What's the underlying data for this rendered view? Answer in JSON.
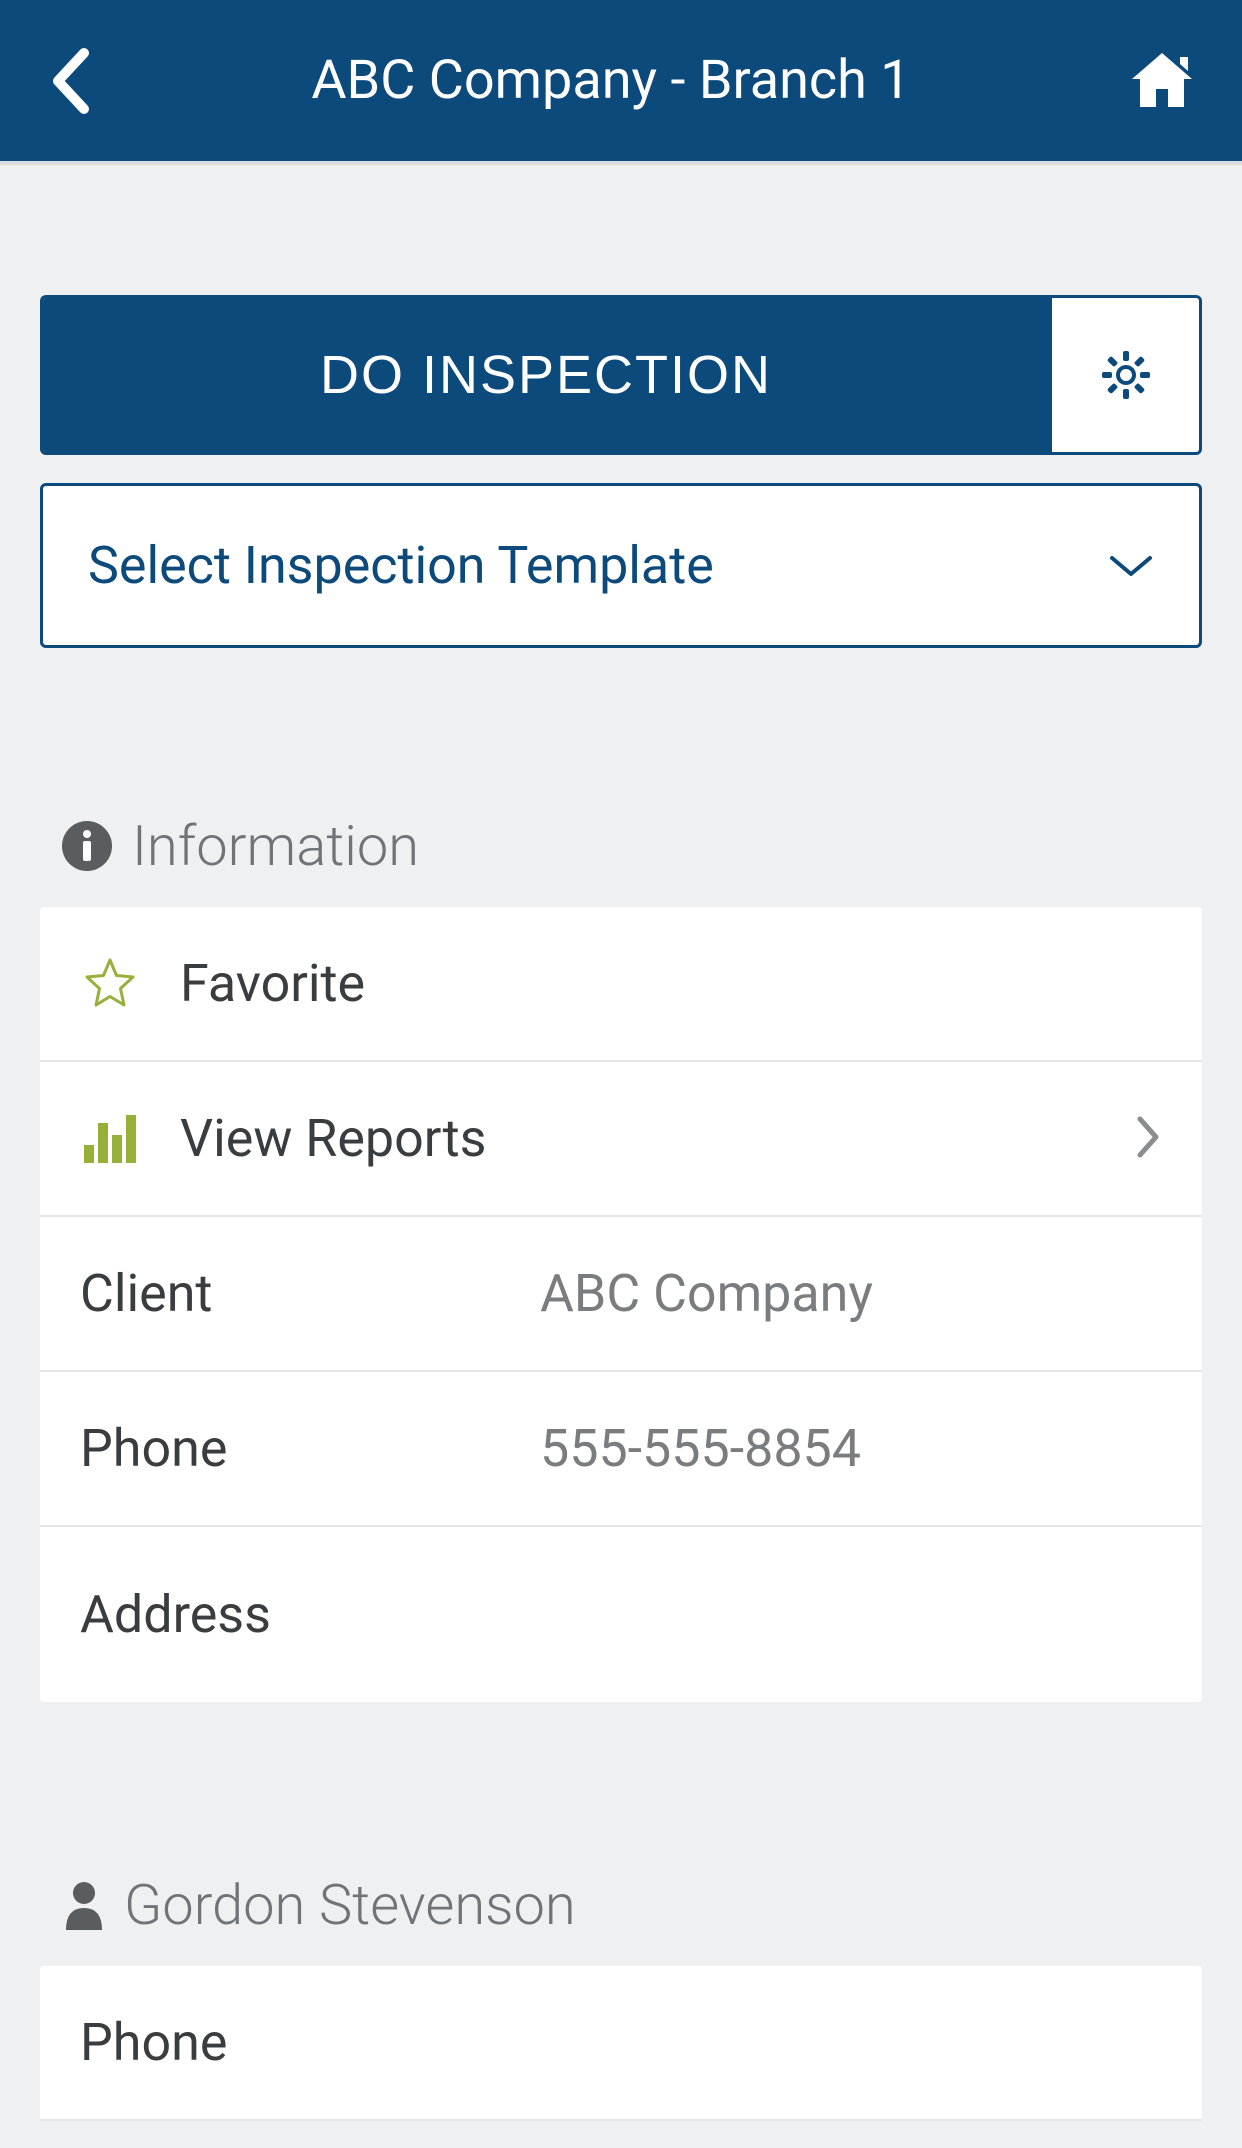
{
  "header": {
    "title": "ABC Company - Branch 1"
  },
  "actions": {
    "do_inspection_label": "DO INSPECTION",
    "select_template_label": "Select Inspection Template"
  },
  "information": {
    "section_title": "Information",
    "favorite_label": "Favorite",
    "view_reports_label": "View Reports",
    "client_label": "Client",
    "client_value": "ABC Company",
    "phone_label": "Phone",
    "phone_value": "555-555-8854",
    "address_label": "Address",
    "address_value": ""
  },
  "contact": {
    "name": "Gordon Stevenson",
    "phone_label": "Phone",
    "phone_value": ""
  }
}
